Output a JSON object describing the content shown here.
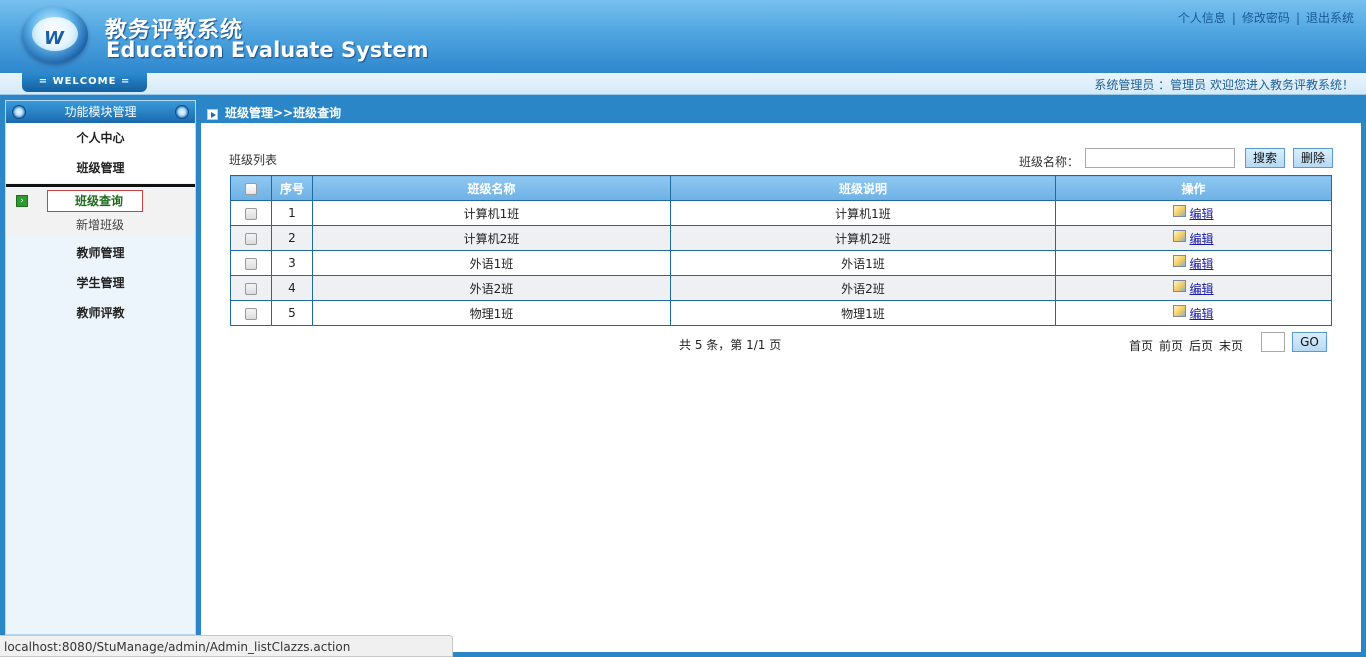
{
  "header": {
    "title_cn": "教务评教系统",
    "title_en": "Education Evaluate System",
    "logo_letter": "W",
    "links": [
      "个人信息",
      "修改密码",
      "退出系统"
    ],
    "separator": "|"
  },
  "welcome": {
    "tab_label": "= WELCOME =",
    "user_text": "系统管理员 ：管理员   欢迎您进入教务评教系统！"
  },
  "sidebar": {
    "title": "功能模块管理",
    "items": [
      "个人中心",
      "班级管理"
    ],
    "submenu": [
      {
        "label": "班级查询",
        "active": true
      },
      {
        "label": "新增班级",
        "active": false
      }
    ],
    "items_after": [
      "教师管理",
      "学生管理",
      "教师评教"
    ]
  },
  "main": {
    "breadcrumb": "班级管理>>班级查询",
    "list_title": "班级列表",
    "search": {
      "label": "班级名称：",
      "value": "",
      "search_button": "搜索",
      "delete_button": "删除"
    },
    "table": {
      "headers": [
        "序号",
        "班级名称",
        "班级说明",
        "操作"
      ],
      "rows": [
        {
          "no": "1",
          "name": "计算机1班",
          "desc": "计算机1班",
          "action": "编辑"
        },
        {
          "no": "2",
          "name": "计算机2班",
          "desc": "计算机2班",
          "action": "编辑"
        },
        {
          "no": "3",
          "name": "外语1班",
          "desc": "外语1班",
          "action": "编辑"
        },
        {
          "no": "4",
          "name": "外语2班",
          "desc": "外语2班",
          "action": "编辑"
        },
        {
          "no": "5",
          "name": "物理1班",
          "desc": "物理1班",
          "action": "编辑"
        }
      ]
    },
    "pager": {
      "info": "共 5 条，第 1/1 页",
      "first": "首页",
      "prev": "前页",
      "next": "后页",
      "last": "末页",
      "page_value": "",
      "go": "GO"
    }
  },
  "statusbar": {
    "url": "localhost:8080/StuManage/admin/Admin_listClazzs.action"
  },
  "colors": {
    "header_blue": "#4fa5e0",
    "frame_blue": "#2a86c6",
    "table_border": "#1e6a9c",
    "active_green": "#1e6b1e",
    "active_border": "#d04040"
  },
  "icons": [
    "logo-icon",
    "knob-icon",
    "arrow-right-icon",
    "edit-icon",
    "checkbox-icon"
  ]
}
